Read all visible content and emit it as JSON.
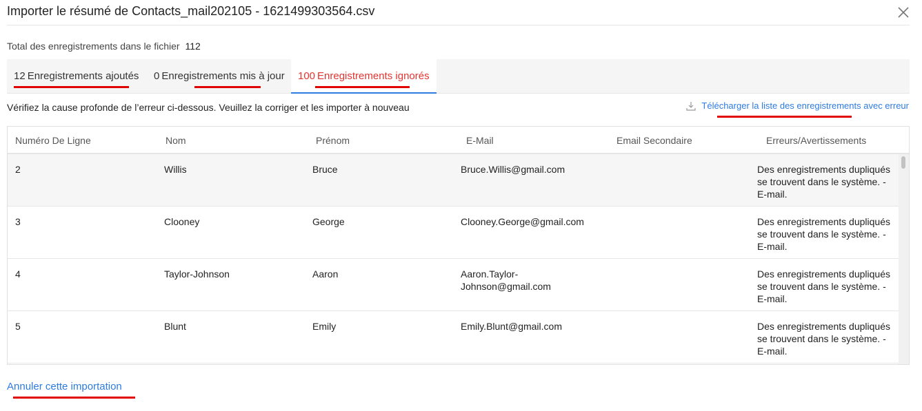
{
  "dialog": {
    "title_prefix": "Importer le résumé de",
    "file_name": "Contacts_mail202105 - 1621499303564.csv"
  },
  "summary": {
    "total_label": "Total des enregistrements dans le fichier",
    "total_value": "112"
  },
  "tabs": [
    {
      "count": "12",
      "label": "Enregistrements ajoutés",
      "active": false
    },
    {
      "count": "0",
      "label": "Enregistrements mis à jour",
      "active": false
    },
    {
      "count": "100",
      "label": "Enregistrements ignorés",
      "active": true
    }
  ],
  "note": "Vérifiez la cause profonde de l’erreur ci-dessous. Veuillez la corriger et les importer à nouveau",
  "download_label": "Télécharger la liste des enregistrements avec erreur",
  "table": {
    "columns": [
      "Numéro De Ligne",
      "Nom",
      "Prénom",
      "E-Mail",
      "Email Secondaire",
      "Erreurs/Avertissements"
    ],
    "rows": [
      {
        "line": "2",
        "nom": "Willis",
        "prenom": "Bruce",
        "email": "Bruce.Willis@gmail.com",
        "email_secondaire": "",
        "erreur": "Des enregistrements dupliqués se trouvent dans le système. - E-mail."
      },
      {
        "line": "3",
        "nom": "Clooney",
        "prenom": "George",
        "email": "Clooney.George@gmail.com",
        "email_secondaire": "",
        "erreur": "Des enregistrements dupliqués se trouvent dans le système. - E-mail."
      },
      {
        "line": "4",
        "nom": "Taylor-Johnson",
        "prenom": "Aaron",
        "email": "Aaron.Taylor-Johnson@gmail.com",
        "email_secondaire": "",
        "erreur": "Des enregistrements dupliqués se trouvent dans le système. - E-mail."
      },
      {
        "line": "5",
        "nom": "Blunt",
        "prenom": "Emily",
        "email": "Emily.Blunt@gmail.com",
        "email_secondaire": "",
        "erreur": "Des enregistrements dupliqués se trouvent dans le système. - E-mail."
      }
    ]
  },
  "cancel_label": "Annuler cette importation",
  "colors": {
    "link": "#2d7be0",
    "active_tab_text": "#e3342f",
    "active_tab_underline": "#2d7be0",
    "annotation_underline": "#e00000"
  }
}
